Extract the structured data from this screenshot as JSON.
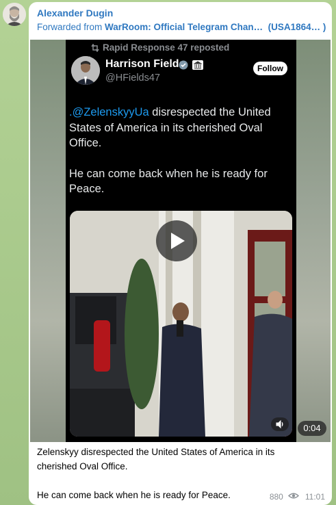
{
  "chat": {
    "background_color": "#a9c98c"
  },
  "message": {
    "sender": "Alexander Dugin",
    "forwarded_prefix": "Forwarded from",
    "forwarded_source": "WarRoom: Official Telegram Chan…",
    "forwarded_suffix": "(USA1864…  )",
    "caption_line1": "Zelenskyy disrespected the United States of America in its cherished Oval Office.",
    "caption_line2": "He can come back when he is ready for Peace.",
    "views": "880",
    "time": "11:01",
    "link_color": "#2f78c0"
  },
  "tweet": {
    "reposted_by": "Rapid Response 47 reposted",
    "author_name": "Harrison Fields",
    "author_handle": "@HFields47",
    "follow_label": "Follow",
    "mention": ".@ZelenskyyUa",
    "text_part1": " disrespected the United States of America in its cherished Oval Office.",
    "text_part2": "He can come back when he is ready for Peace.",
    "mention_color": "#1d9bf0"
  },
  "video": {
    "duration": "0:04"
  },
  "icons": {
    "repost": "repost-icon",
    "verified": "verified-badge-icon",
    "government": "government-building-icon",
    "play": "play-icon",
    "volume": "volume-icon",
    "views": "eye-icon"
  }
}
